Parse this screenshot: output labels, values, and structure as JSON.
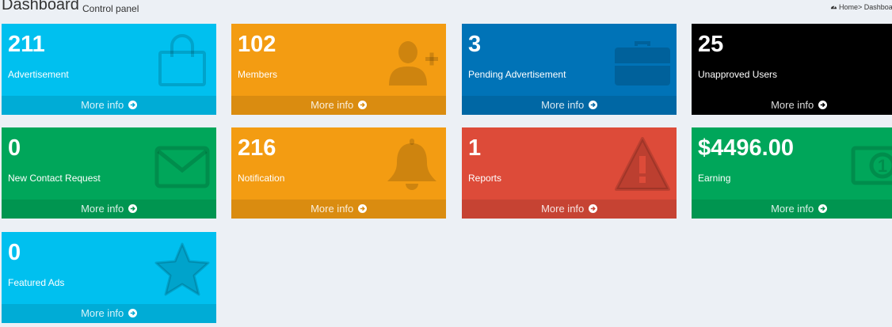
{
  "header": {
    "title": "Dashboard",
    "subtitle": "Control panel",
    "breadcrumb": "Home> Dashboard",
    "breadcrumb_icon": "dashboard-icon"
  },
  "boxes": [
    {
      "count": "211",
      "label": "Advertisement",
      "more": "More info",
      "icon": "shopping-bag-icon",
      "color": "#00c0ef"
    },
    {
      "count": "102",
      "label": "Members",
      "more": "More info",
      "icon": "user-plus-icon",
      "color": "#f39c12"
    },
    {
      "count": "3",
      "label": "Pending Advertisement",
      "more": "More info",
      "icon": "briefcase-icon",
      "color": "#0073b7"
    },
    {
      "count": "25",
      "label": "Unapproved Users",
      "more": "More info",
      "icon": "",
      "color": "#000000"
    },
    {
      "count": "0",
      "label": "New Contact Request",
      "more": "More info",
      "icon": "envelope-icon",
      "color": "#00a65a"
    },
    {
      "count": "216",
      "label": "Notification",
      "more": "More info",
      "icon": "bell-icon",
      "color": "#f39c12"
    },
    {
      "count": "1",
      "label": "Reports",
      "more": "More info",
      "icon": "warning-icon",
      "color": "#dd4b39"
    },
    {
      "count": "$4496.00",
      "label": "Earning",
      "more": "More info",
      "icon": "money-icon",
      "color": "#00a65a"
    },
    {
      "count": "0",
      "label": "Featured Ads",
      "more": "More info",
      "icon": "star-icon",
      "color": "#00c0ef"
    }
  ]
}
